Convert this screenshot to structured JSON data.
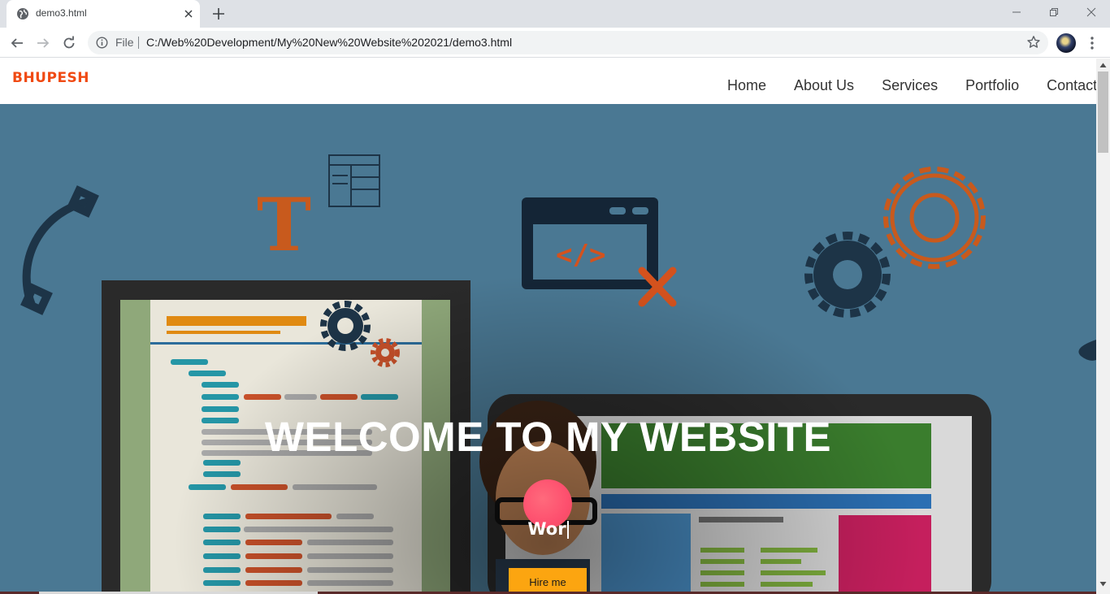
{
  "browser": {
    "tab_title": "demo3.html",
    "scheme_label": "File",
    "url": "C:/Web%20Development/My%20New%20Website%202021/demo3.html"
  },
  "site": {
    "logo": "BHUPESH",
    "menu": [
      "Home",
      "About Us",
      "Services",
      "Portfolio",
      "Contact"
    ],
    "hero_title": "WELCOME TO MY WEBSITE",
    "typed_text": "Wor",
    "hire_button": "Hire me"
  },
  "colors": {
    "logo": "#f04a13",
    "hero_bg": "#4a7893",
    "hire_button": "#fca510",
    "blob": "#fd4f6e"
  },
  "icons": {
    "favicon": "globe-icon",
    "tab_close": "close-icon",
    "new_tab": "plus-icon",
    "back": "arrow-left-icon",
    "forward": "arrow-right-icon",
    "reload": "reload-icon",
    "site_info": "info-icon",
    "bookmark": "star-icon",
    "menu": "kebab-icon"
  }
}
